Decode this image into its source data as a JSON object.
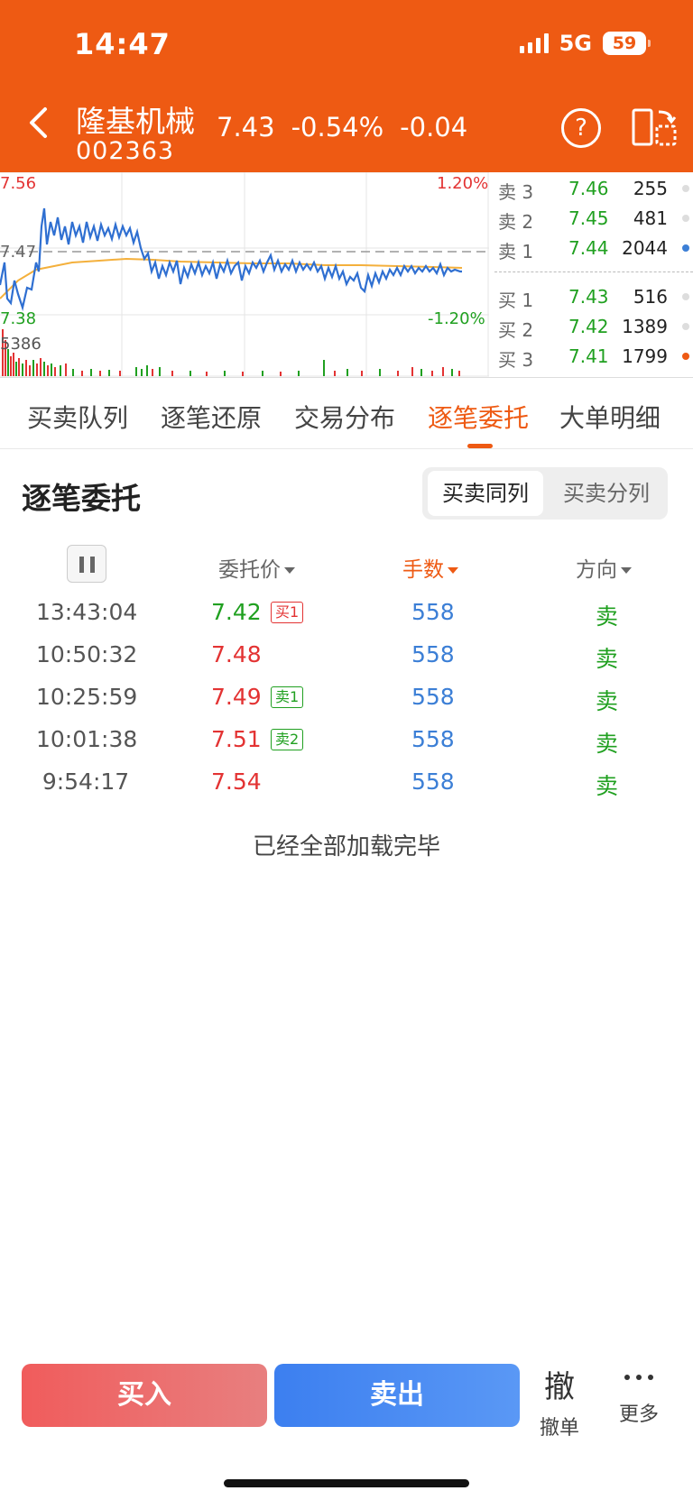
{
  "status_bar": {
    "time": "14:47",
    "network": "5G",
    "battery": "59"
  },
  "header": {
    "stock_name": "隆基机械",
    "stock_code": "002363",
    "price": "7.43",
    "change_pct": "-0.54%",
    "change": "-0.04",
    "help_label": "?"
  },
  "intraday": {
    "high_label": "7.56",
    "mid_label": "7.47",
    "low_label": "7.38",
    "up_pct_label": "1.20%",
    "down_pct_label": "-1.20%",
    "volume_label": "5386",
    "colors": {
      "price_line": "#2f6fd1",
      "avg_line": "#f4b03c",
      "up": "#e33333",
      "down": "#20a020"
    }
  },
  "order_book": {
    "asks": [
      {
        "label": "卖 3",
        "price": "7.46",
        "volume": "255",
        "dot": "#dddddd"
      },
      {
        "label": "卖 2",
        "price": "7.45",
        "volume": "481",
        "dot": "#dddddd"
      },
      {
        "label": "卖 1",
        "price": "7.44",
        "volume": "2044",
        "dot": "#3c7fd6"
      }
    ],
    "bids": [
      {
        "label": "买 1",
        "price": "7.43",
        "volume": "516",
        "dot": "#dddddd"
      },
      {
        "label": "买 2",
        "price": "7.42",
        "volume": "1389",
        "dot": "#dddddd"
      },
      {
        "label": "买 3",
        "price": "7.41",
        "volume": "1799",
        "dot": "#ee5a13"
      }
    ]
  },
  "tabs": [
    "买卖队列",
    "逐笔还原",
    "交易分布",
    "逐笔委托",
    "大单明细"
  ],
  "active_tab": "逐笔委托",
  "section": {
    "title": "逐笔委托",
    "segment_on": "买卖同列",
    "segment_off": "买卖分列"
  },
  "table": {
    "headers": {
      "price": "委托价",
      "qty": "手数",
      "direction": "方向"
    },
    "rows": [
      {
        "time": "13:43:04",
        "price": "7.42",
        "price_color": "#20a020",
        "tag": "买1",
        "tag_color": "#e33333",
        "qty": "558",
        "dir": "卖"
      },
      {
        "time": "10:50:32",
        "price": "7.48",
        "price_color": "#e33333",
        "tag": "",
        "tag_color": "",
        "qty": "558",
        "dir": "卖"
      },
      {
        "time": "10:25:59",
        "price": "7.49",
        "price_color": "#e33333",
        "tag": "卖1",
        "tag_color": "#20a020",
        "qty": "558",
        "dir": "卖"
      },
      {
        "time": "10:01:38",
        "price": "7.51",
        "price_color": "#e33333",
        "tag": "卖2",
        "tag_color": "#20a020",
        "qty": "558",
        "dir": "卖"
      },
      {
        "time": "9:54:17",
        "price": "7.54",
        "price_color": "#e33333",
        "tag": "",
        "tag_color": "",
        "qty": "558",
        "dir": "卖"
      }
    ],
    "footer": "已经全部加载完毕"
  },
  "bottom_bar": {
    "buy": "买入",
    "sell": "卖出",
    "cancel_icon_text": "撤",
    "cancel": "撤单",
    "more": "更多"
  }
}
